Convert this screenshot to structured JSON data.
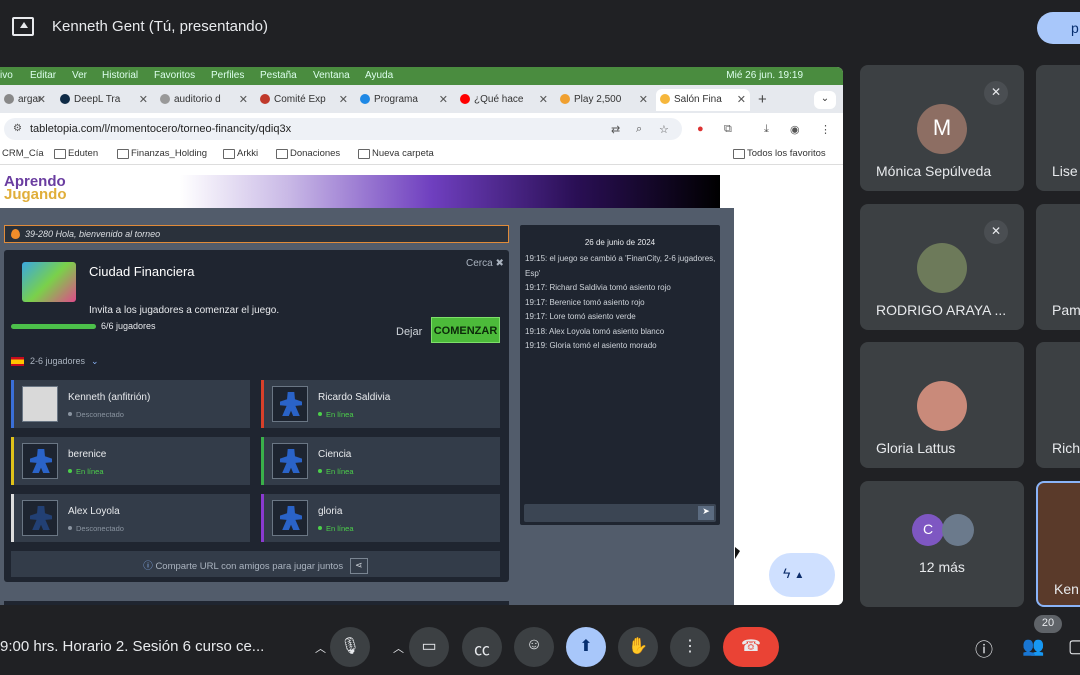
{
  "banner": {
    "title": "Kenneth Gent (Tú, presentando)",
    "present_label": "p"
  },
  "mac_menu": {
    "items": [
      "ivo",
      "Editar",
      "Ver",
      "Historial",
      "Favoritos",
      "Perfiles",
      "Pestaña",
      "Ventana",
      "Ayuda"
    ],
    "clock": "Mié 26 jun.  19:19"
  },
  "browser": {
    "tabs": [
      {
        "label": "argar",
        "color": "#888888"
      },
      {
        "label": "DeepL Tra",
        "color": "#0f2b46"
      },
      {
        "label": "auditorio d",
        "color": "#999999"
      },
      {
        "label": "Comité Exp",
        "color": "#c0392b"
      },
      {
        "label": "Programa",
        "color": "#1e88e5"
      },
      {
        "label": "¿Qué hace",
        "color": "#ff0000"
      },
      {
        "label": "Play 2,500",
        "color": "#f0a030"
      },
      {
        "label": "Salón Fina",
        "color": "#f6b73c"
      }
    ],
    "new_tab": "+",
    "url": "tabletopia.com/l/momentocero/torneo-financity/qdiq3x",
    "bookmarks": [
      "CRM_Cía",
      "Eduten",
      "Finanzas_Holding",
      "Arkki",
      "Donaciones",
      "Nueva carpeta"
    ],
    "all_bookmarks": "Todos los favoritos"
  },
  "site": {
    "logo_line1": "Aprendo",
    "logo_line2": "Jugando"
  },
  "lobby": {
    "welcome": "39-280 Hola, bienvenido al torneo",
    "game_title": "Ciudad Financiera",
    "close_label": "Cerca ✖",
    "invite_text": "Invita a los jugadores a comenzar el juego.",
    "progress_fraction": 1.0,
    "progress_text": "6/6 jugadores",
    "leave_label": "Dejar",
    "start_label": "COMENZAR",
    "players_range": "2-6 jugadores",
    "share_text": "Comparte URL con amigos para jugar juntos",
    "players": [
      {
        "name": "Kenneth (anfitrión)",
        "status": "Desconectado",
        "online": false,
        "seat_color": "#3a6fd8"
      },
      {
        "name": "Ricardo Saldivia",
        "status": "En línea",
        "online": true,
        "seat_color": "#d8402a"
      },
      {
        "name": "berenice",
        "status": "En línea",
        "online": true,
        "seat_color": "#e0c21a"
      },
      {
        "name": "Ciencia",
        "status": "En línea",
        "online": true,
        "seat_color": "#3ab04a"
      },
      {
        "name": "Alex Loyola",
        "status": "Desconectado",
        "online": false,
        "seat_color": "#dddddd"
      },
      {
        "name": "gloria",
        "status": "En línea",
        "online": true,
        "seat_color": "#8a3ad0"
      }
    ]
  },
  "chat": {
    "date": "26 de junio de 2024",
    "lines": [
      "19:15: el juego se cambió a 'FinanCity, 2-6 jugadores, Esp'",
      "19:17: Richard Saldivia tomó asiento rojo",
      "19:17: Berenice tomó asiento rojo",
      "19:17: Lore tomó asiento verde",
      "19:18: Alex Loyola tomó asiento blanco",
      "19:19: Gloria tomó el asiento morado"
    ]
  },
  "participants": [
    {
      "name": "Mónica Sepúlveda",
      "initial": "M",
      "avatar_color": "#8d6e63",
      "muted": true
    },
    {
      "name": "RODRIGO ARAYA ...",
      "initial": "",
      "avatar_color": "#6d7a5a",
      "muted": true
    },
    {
      "name": "Gloria Lattus",
      "initial": "",
      "avatar_color": "#c98a7a",
      "muted": false
    },
    {
      "name": "12 más",
      "initial": "C",
      "avatar_color": "#7e57c2",
      "muted": false
    }
  ],
  "edge_tiles": [
    "Lise",
    "Pam",
    "Rich",
    "Ken"
  ],
  "bottom": {
    "meeting_name": "9:00 hrs. Horario 2. Sesión 6 curso ce...",
    "participant_count": "20"
  }
}
